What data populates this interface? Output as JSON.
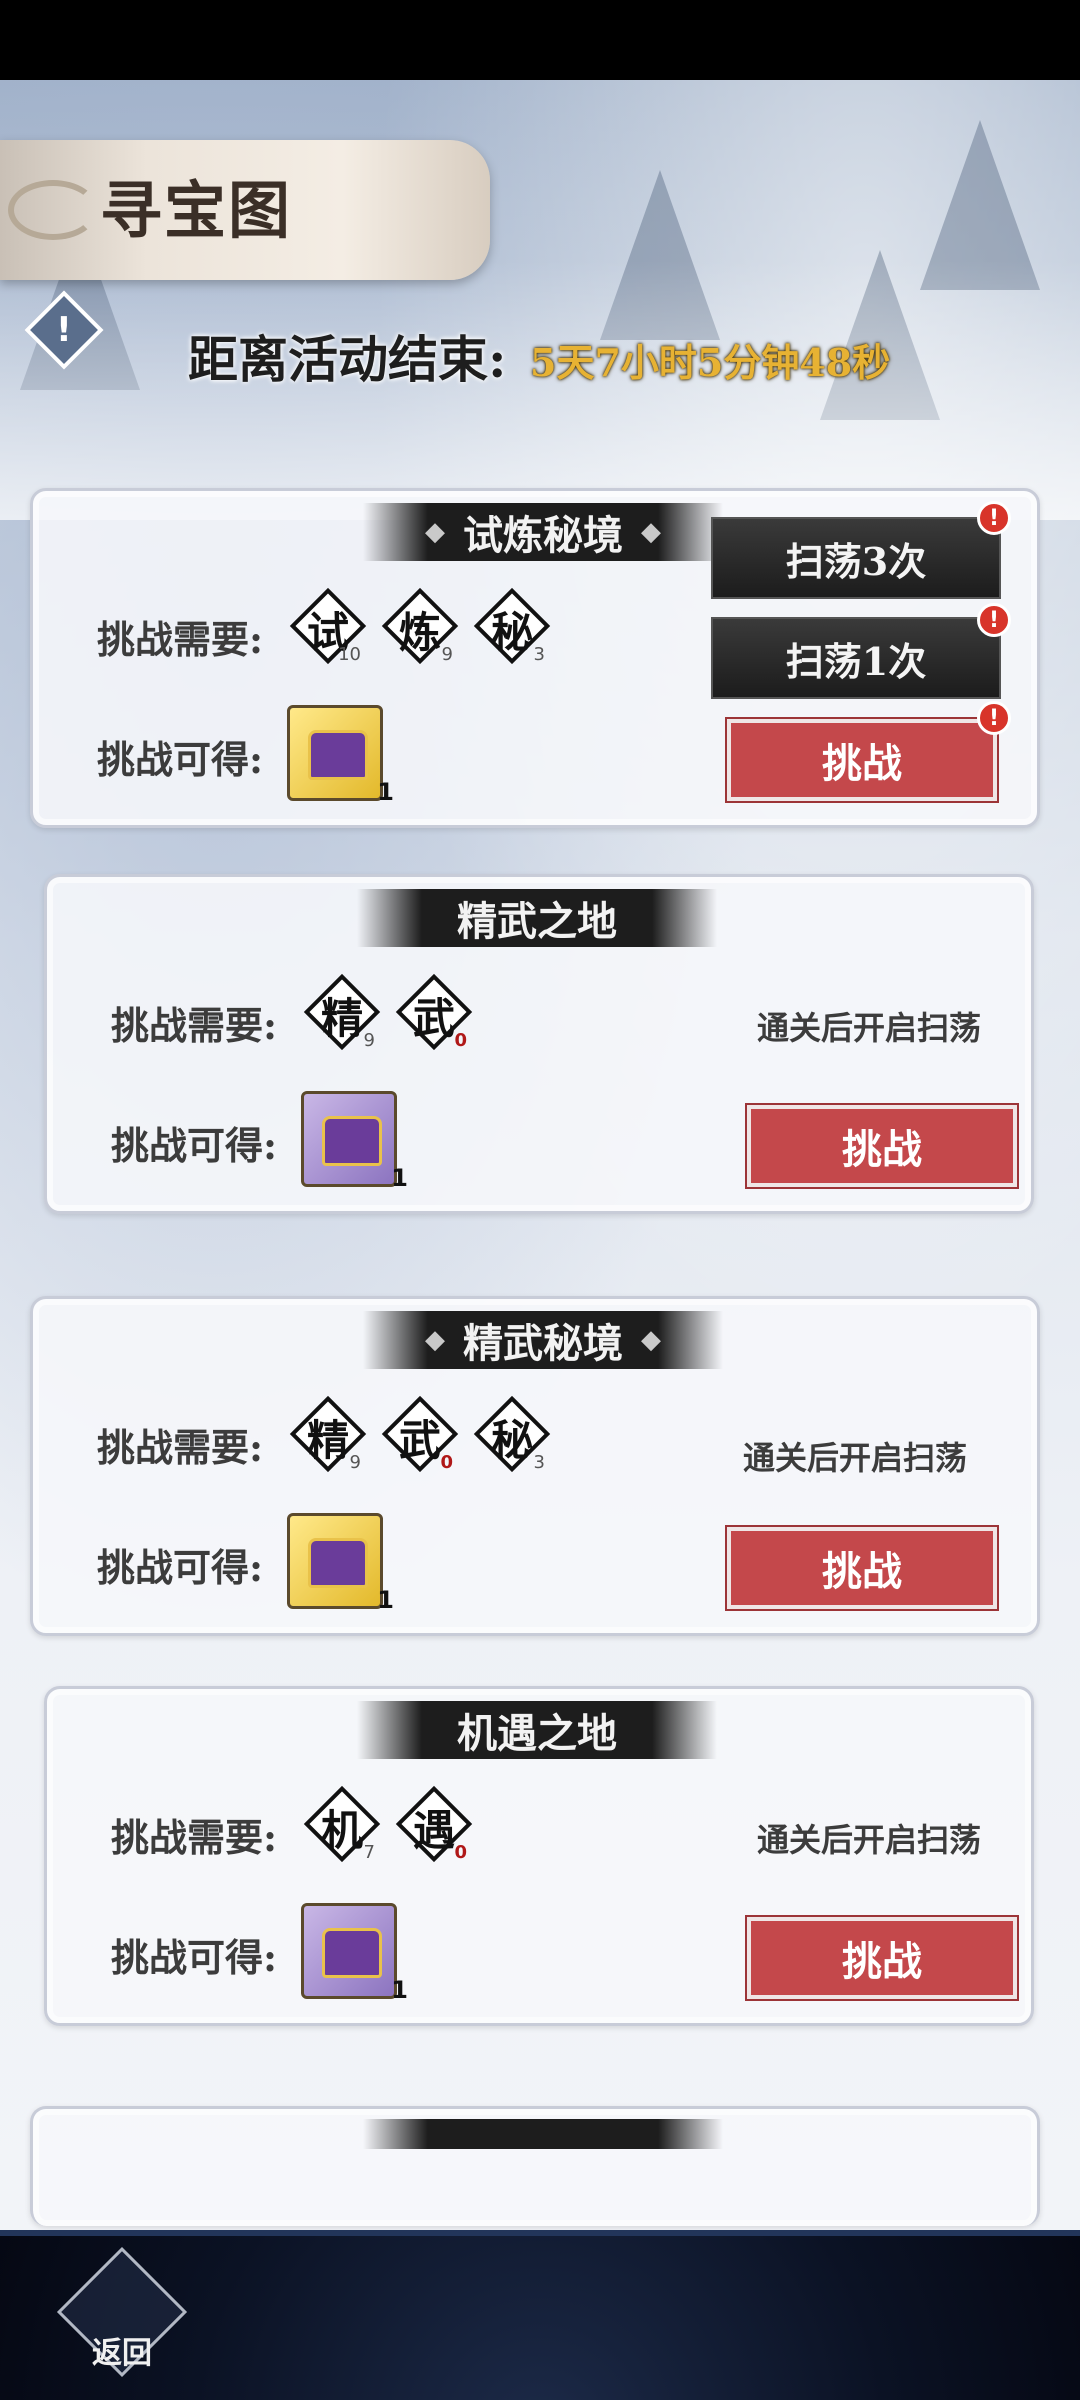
{
  "header": {
    "title": "寻宝图",
    "countdown_label": "距离活动结束:",
    "countdown_value": "5天7小时5分钟48秒"
  },
  "cards": [
    {
      "title": "试炼秘境",
      "require_label": "挑战需要:",
      "reward_label": "挑战可得:",
      "fragments": [
        {
          "char": "试",
          "count": "10"
        },
        {
          "char": "炼",
          "count": "9"
        },
        {
          "char": "秘",
          "count": "3"
        }
      ],
      "reward_count": "1",
      "sweep3": "扫荡3次",
      "sweep1": "扫荡1次",
      "challenge": "挑战"
    },
    {
      "title": "精武之地",
      "require_label": "挑战需要:",
      "reward_label": "挑战可得:",
      "fragments": [
        {
          "char": "精",
          "count": "9"
        },
        {
          "char": "武",
          "count": "0"
        }
      ],
      "reward_count": "1",
      "hint": "通关后开启扫荡",
      "challenge": "挑战"
    },
    {
      "title": "精武秘境",
      "require_label": "挑战需要:",
      "reward_label": "挑战可得:",
      "fragments": [
        {
          "char": "精",
          "count": "9"
        },
        {
          "char": "武",
          "count": "0"
        },
        {
          "char": "秘",
          "count": "3"
        }
      ],
      "reward_count": "1",
      "hint": "通关后开启扫荡",
      "challenge": "挑战"
    },
    {
      "title": "机遇之地",
      "require_label": "挑战需要:",
      "reward_label": "挑战可得:",
      "fragments": [
        {
          "char": "机",
          "count": "7"
        },
        {
          "char": "遇",
          "count": "0"
        }
      ],
      "reward_count": "1",
      "hint": "通关后开启扫荡",
      "challenge": "挑战"
    }
  ],
  "footer": {
    "back_label": "返回"
  },
  "icons": {
    "warning": "warning-icon",
    "badge": "!"
  },
  "colors": {
    "challenge_red": "#c4484b",
    "countdown_gold": "#e7b233"
  }
}
